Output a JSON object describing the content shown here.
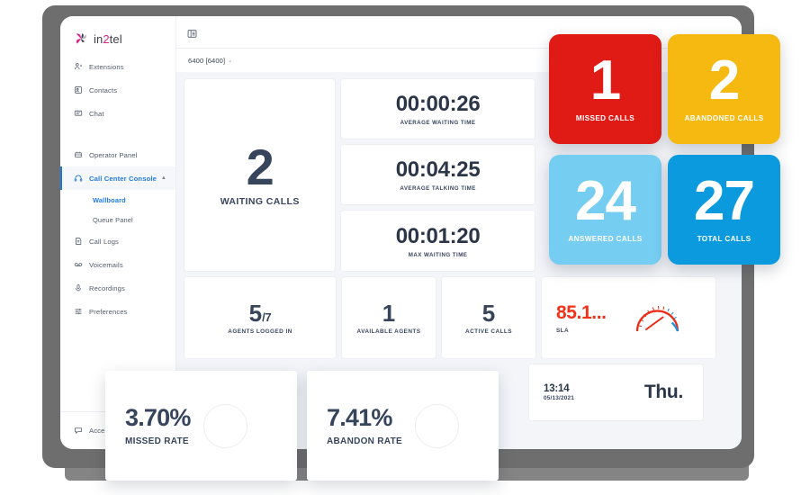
{
  "brand": {
    "name_prefix": "in",
    "name_accent": "2",
    "name_suffix": "tel",
    "logo_icon": "pinwheel-logo-icon"
  },
  "sidebar": {
    "items": [
      {
        "label": "Extensions",
        "icon": "people-icon"
      },
      {
        "label": "Contacts",
        "icon": "contact-card-icon"
      },
      {
        "label": "Chat",
        "icon": "chat-bubble-icon"
      },
      {
        "label": "Operator Panel",
        "icon": "operator-grid-icon"
      },
      {
        "label": "Call Center Console",
        "icon": "headset-icon",
        "chevron": "▲"
      },
      {
        "label": "Call Logs",
        "icon": "call-log-icon"
      },
      {
        "label": "Voicemails",
        "icon": "voicemail-icon"
      },
      {
        "label": "Recordings",
        "icon": "microphone-icon"
      },
      {
        "label": "Preferences",
        "icon": "sliders-icon"
      }
    ],
    "sub_items": [
      {
        "label": "Wallboard"
      },
      {
        "label": "Queue Panel"
      }
    ],
    "footer": {
      "label": "Acces",
      "icon": "accessibility-chat-icon"
    }
  },
  "topbar": {
    "toggle_icon": "sidebar-toggle-icon"
  },
  "queue_selector": {
    "value": "6400 [6400]",
    "caret": "⌄"
  },
  "dashboard": {
    "waiting_calls": {
      "value": "2",
      "label": "WAITING CALLS"
    },
    "average_waiting_time": {
      "value": "00:00:26",
      "label": "AVERAGE WAITING TIME"
    },
    "average_talking_time": {
      "value": "00:04:25",
      "label": "AVERAGE TALKING TIME"
    },
    "max_waiting_time": {
      "value": "00:01:20",
      "label": "MAX WAITING TIME"
    },
    "agents_logged_in": {
      "value": "5",
      "sub_value": "/7",
      "label": "AGENTS LOGGED IN"
    },
    "available_agents": {
      "value": "1",
      "label": "AVAILABLE AGENTS"
    },
    "active_calls": {
      "value": "5",
      "label": "ACTIVE CALLS"
    },
    "sla": {
      "value": "85.1...",
      "label": "SLA",
      "color": "#f0331a",
      "gauge_icon": "speedometer-gauge-icon"
    },
    "clock": {
      "time": "13:14",
      "date": "05/13/2021",
      "day": "Thu."
    }
  },
  "tiles": [
    {
      "id": "missed",
      "value": "1",
      "label": "MISSED CALLS",
      "color": "#e01b16"
    },
    {
      "id": "abandoned",
      "value": "2",
      "label": "ABANDONED CALLS",
      "color": "#f5b912"
    },
    {
      "id": "answered",
      "value": "24",
      "label": "ANSWERED CALLS",
      "color": "#76cdf2"
    },
    {
      "id": "total",
      "value": "27",
      "label": "TOTAL CALLS",
      "color": "#0b9ade"
    }
  ],
  "rate_cards": [
    {
      "id": "missed_rate",
      "value": "3.70%",
      "label": "MISSED RATE"
    },
    {
      "id": "abandon_rate",
      "value": "7.41%",
      "label": "ABANDON RATE"
    }
  ]
}
